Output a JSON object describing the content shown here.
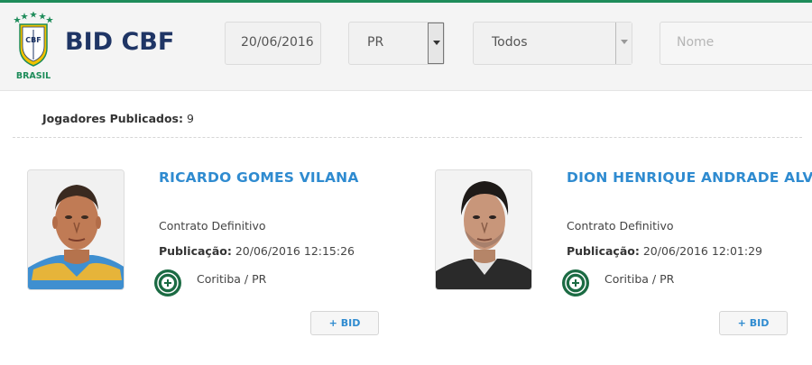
{
  "header": {
    "brand": "BID CBF",
    "logo_text": "BRASIL",
    "logo_badge": "CBF"
  },
  "filters": {
    "date": "20/06/2016",
    "state": "PR",
    "club": "Todos",
    "name_placeholder": "Nome"
  },
  "summary": {
    "label": "Jogadores Publicados:",
    "count": "9"
  },
  "players": [
    {
      "name": "RICARDO GOMES VILANA",
      "contract": "Contrato Definitivo",
      "pub_label": "Publicação:",
      "pub_date": "20/06/2016 12:15:26",
      "club": "Coritiba / PR",
      "bid_label": "+ BID"
    },
    {
      "name": "DION HENRIQUE ANDRADE ALVES",
      "contract": "Contrato Definitivo",
      "pub_label": "Publicação:",
      "pub_date": "20/06/2016 12:01:29",
      "club": "Coritiba / PR",
      "bid_label": "+ BID"
    }
  ],
  "colors": {
    "brand": "#1f3565",
    "accent": "#2f8bd0",
    "topline": "#1e8c5a",
    "crest": "#1b6b43"
  }
}
